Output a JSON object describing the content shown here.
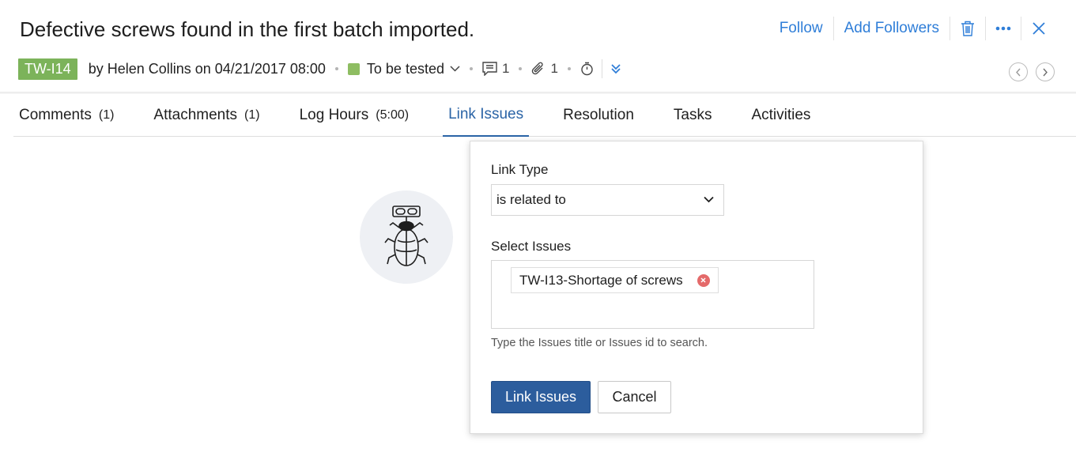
{
  "issue": {
    "title": "Defective screws found in the first batch imported.",
    "id": "TW-I14",
    "byline": "by Helen Collins on 04/21/2017 08:00",
    "status": "To be tested",
    "comment_count": "1",
    "attachment_count": "1"
  },
  "actions": {
    "follow": "Follow",
    "add_followers": "Add Followers"
  },
  "tabs": [
    {
      "label": "Comments",
      "count": "(1)"
    },
    {
      "label": "Attachments",
      "count": "(1)"
    },
    {
      "label": "Log Hours",
      "count": "(5:00)"
    },
    {
      "label": "Link Issues",
      "count": ""
    },
    {
      "label": "Resolution",
      "count": ""
    },
    {
      "label": "Tasks",
      "count": ""
    },
    {
      "label": "Activities",
      "count": ""
    }
  ],
  "active_tab": "Link Issues",
  "link_form": {
    "link_type_label": "Link Type",
    "link_type_value": "is related to",
    "select_issues_label": "Select Issues",
    "selected_issue": "TW-I13-Shortage of screws",
    "hint": "Type the Issues title or Issues id to search.",
    "submit_label": "Link Issues",
    "cancel_label": "Cancel"
  },
  "colors": {
    "accent": "#2f7ed8",
    "primary_button": "#2c5d9d",
    "badge": "#7cb35a",
    "status": "#8ebd62",
    "remove": "#e46a6a"
  },
  "icons": [
    "trash-icon",
    "more-icon",
    "close-icon",
    "comment-icon",
    "paperclip-icon",
    "timer-icon",
    "double-chevron-down-icon",
    "chevron-left-icon",
    "chevron-right-icon",
    "bug-icon",
    "chevron-down-icon",
    "remove-icon"
  ]
}
